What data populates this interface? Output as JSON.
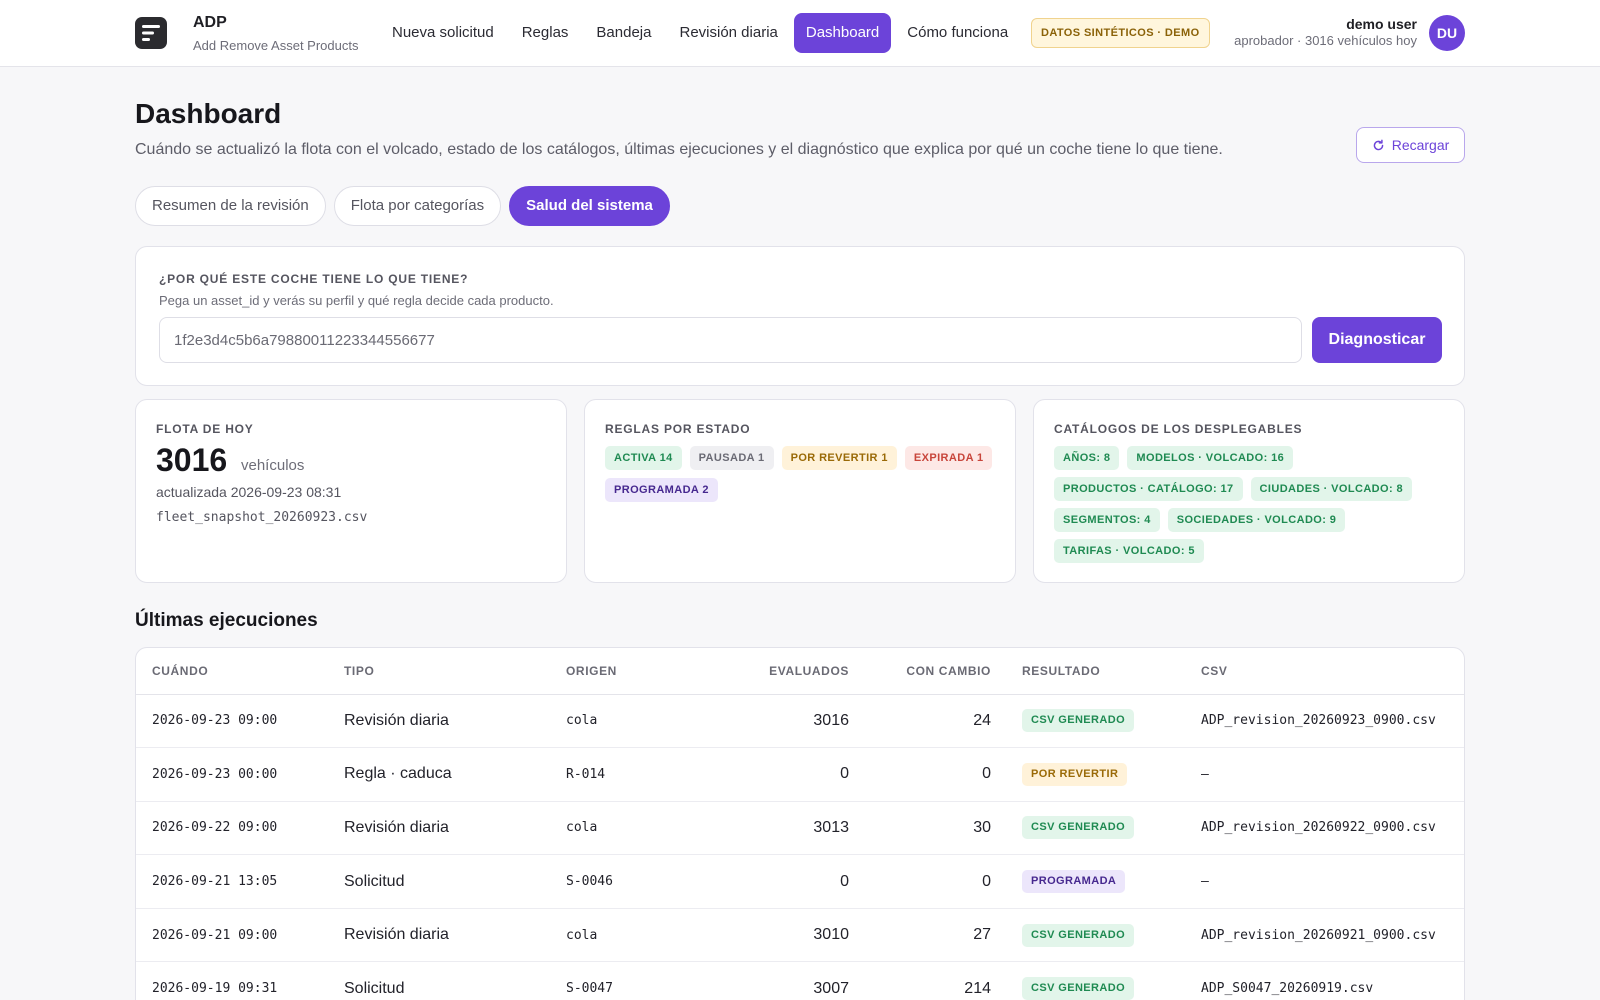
{
  "header": {
    "brand_title": "ADP",
    "brand_subtitle": "Add Remove Asset Products",
    "nav": [
      {
        "label": "Nueva solicitud"
      },
      {
        "label": "Reglas"
      },
      {
        "label": "Bandeja"
      },
      {
        "label": "Revisión diaria"
      },
      {
        "label": "Dashboard",
        "active": true
      },
      {
        "label": "Cómo funciona"
      }
    ],
    "demo_badge": "DATOS SINTÉTICOS · DEMO",
    "user_name": "demo user",
    "user_meta": "aprobador · 3016 vehículos hoy",
    "avatar_initials": "DU",
    "accent_color": "#6c43d9"
  },
  "page": {
    "title": "Dashboard",
    "subtitle": "Cuándo se actualizó la flota con el volcado, estado de los catálogos, últimas ejecuciones y el diagnóstico que explica por qué un coche tiene lo que tiene.",
    "reload_label": "Recargar"
  },
  "subtabs": [
    {
      "label": "Resumen de la revisión"
    },
    {
      "label": "Flota por categorías"
    },
    {
      "label": "Salud del sistema",
      "active": true
    }
  ],
  "diagnostic": {
    "label": "¿Por qué este coche tiene lo que tiene?",
    "help": "Pega un asset_id y verás su perfil y qué regla decide cada producto.",
    "input_value": "1f2e3d4c5b6a79880011223344556677",
    "button_label": "Diagnosticar"
  },
  "fleet": {
    "label": "Flota de hoy",
    "count": "3016",
    "unit": "vehículos",
    "updated": "actualizada 2026-09-23 08:31",
    "file": "fleet_snapshot_20260923.csv"
  },
  "rules": {
    "label": "Reglas por estado",
    "chips": [
      {
        "text": "Activa 14",
        "tone": "green"
      },
      {
        "text": "Pausada 1",
        "tone": "gray"
      },
      {
        "text": "Por revertir 1",
        "tone": "amber"
      },
      {
        "text": "Expirada 1",
        "tone": "red"
      },
      {
        "text": "Programada 2",
        "tone": "purple"
      }
    ]
  },
  "catalogs": {
    "label": "Catálogos de los desplegables",
    "chips": [
      {
        "text": "Años: 8"
      },
      {
        "text": "Modelos · volcado: 16"
      },
      {
        "text": "Productos · catálogo: 17"
      },
      {
        "text": "Ciudades · volcado: 8"
      },
      {
        "text": "Segmentos: 4"
      },
      {
        "text": "Sociedades · volcado: 9"
      },
      {
        "text": "Tarifas · volcado: 5"
      }
    ]
  },
  "executions": {
    "title": "Últimas ejecuciones",
    "columns": [
      "Cuándo",
      "Tipo",
      "Origen",
      "Evaluados",
      "Con cambio",
      "Resultado",
      "CSV"
    ],
    "rows": [
      {
        "when": "2026-09-23 09:00",
        "type": "Revisión diaria",
        "origin": "cola",
        "evaluated": "3016",
        "changed": "24",
        "result": "CSV generado",
        "tone": "green",
        "csv": "ADP_revision_20260923_0900.csv"
      },
      {
        "when": "2026-09-23 00:00",
        "type": "Regla · caduca",
        "origin": "R-014",
        "evaluated": "0",
        "changed": "0",
        "result": "Por revertir",
        "tone": "amber",
        "csv": "—"
      },
      {
        "when": "2026-09-22 09:00",
        "type": "Revisión diaria",
        "origin": "cola",
        "evaluated": "3013",
        "changed": "30",
        "result": "CSV generado",
        "tone": "green",
        "csv": "ADP_revision_20260922_0900.csv"
      },
      {
        "when": "2026-09-21 13:05",
        "type": "Solicitud",
        "origin": "S-0046",
        "evaluated": "0",
        "changed": "0",
        "result": "Programada",
        "tone": "purple",
        "csv": "—"
      },
      {
        "when": "2026-09-21 09:00",
        "type": "Revisión diaria",
        "origin": "cola",
        "evaluated": "3010",
        "changed": "27",
        "result": "CSV generado",
        "tone": "green",
        "csv": "ADP_revision_20260921_0900.csv"
      },
      {
        "when": "2026-09-19 09:31",
        "type": "Solicitud",
        "origin": "S-0047",
        "evaluated": "3007",
        "changed": "214",
        "result": "CSV generado",
        "tone": "green",
        "csv": "ADP_S0047_20260919.csv"
      }
    ]
  }
}
